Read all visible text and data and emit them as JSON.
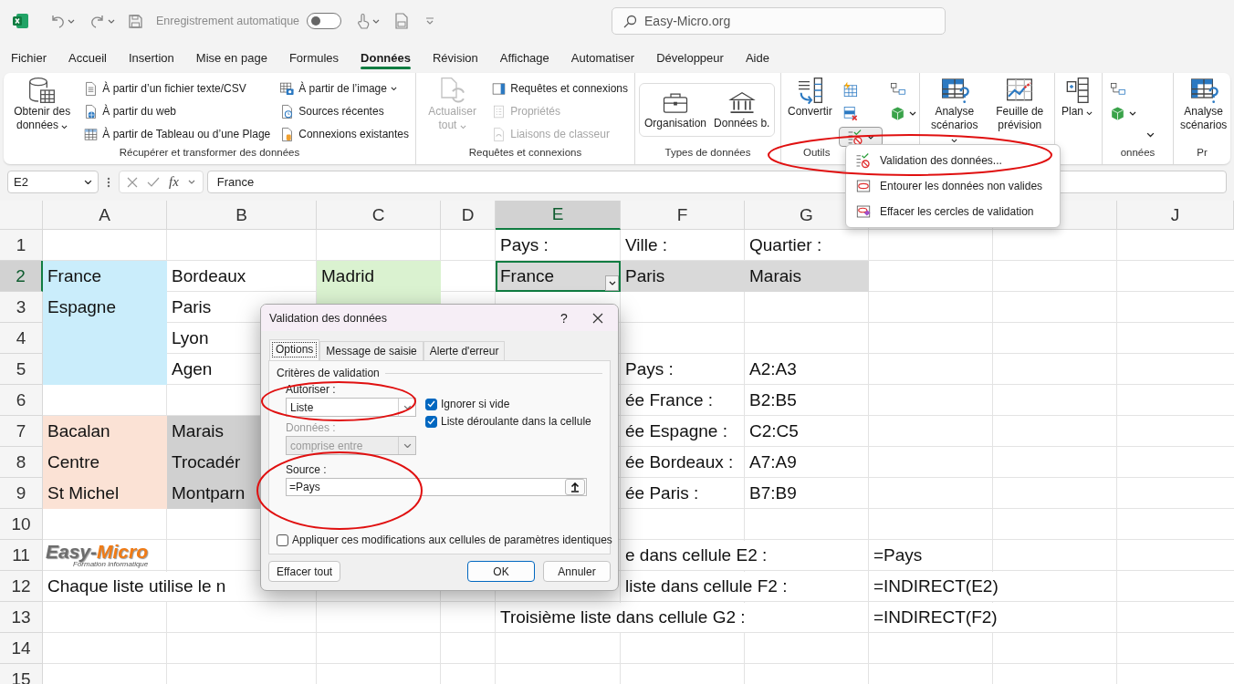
{
  "titlebar": {
    "autosave_label": "Enregistrement automatique",
    "autosave_on": false,
    "search": "Easy-Micro.org"
  },
  "menu_tabs": [
    {
      "label": "Fichier",
      "selected": false
    },
    {
      "label": "Accueil",
      "selected": false
    },
    {
      "label": "Insertion",
      "selected": false
    },
    {
      "label": "Mise en page",
      "selected": false
    },
    {
      "label": "Formules",
      "selected": false
    },
    {
      "label": "Données",
      "selected": true
    },
    {
      "label": "Révision",
      "selected": false
    },
    {
      "label": "Affichage",
      "selected": false
    },
    {
      "label": "Automatiser",
      "selected": false
    },
    {
      "label": "Développeur",
      "selected": false
    },
    {
      "label": "Aide",
      "selected": false
    }
  ],
  "ribbon": [
    {
      "label": "Récupérer et transformer des données",
      "items": [
        {
          "kind": "large",
          "label": "Obtenir des données",
          "dropdown": true,
          "disabled": false
        },
        {
          "kind": "stack",
          "entries": [
            {
              "label": "À partir d’un fichier texte/CSV",
              "dropdown": false,
              "disabled": false
            },
            {
              "label": "À partir du web",
              "dropdown": false,
              "disabled": false
            },
            {
              "label": "À partir de Tableau ou d’une Plage",
              "dropdown": false,
              "disabled": false
            }
          ]
        },
        {
          "kind": "stack",
          "entries": [
            {
              "label": "À partir de l’image",
              "dropdown": true,
              "disabled": false
            },
            {
              "label": "Sources récentes",
              "dropdown": false,
              "disabled": false
            },
            {
              "label": "Connexions existantes",
              "dropdown": false,
              "disabled": false
            }
          ]
        }
      ]
    },
    {
      "label": "Requêtes et connexions",
      "items": [
        {
          "kind": "large",
          "label": "Actualiser tout",
          "dropdown": true,
          "disabled": true
        },
        {
          "kind": "stack",
          "entries": [
            {
              "label": "Requêtes et connexions",
              "dropdown": false,
              "disabled": false
            },
            {
              "label": "Propriétés",
              "dropdown": false,
              "disabled": true
            },
            {
              "label": "Liaisons de classeur",
              "dropdown": false,
              "disabled": true
            }
          ]
        }
      ]
    },
    {
      "label": "Types de données",
      "items": [
        {
          "kind": "gallery",
          "entries": [
            {
              "label": "Organisation"
            },
            {
              "label": "Données b."
            }
          ]
        }
      ]
    },
    {
      "label": "Outils",
      "items": [
        {
          "kind": "large",
          "label": "Convertir",
          "dropdown": false,
          "disabled": false
        },
        {
          "kind": "icons",
          "entries": [
            {
              "dropdown": false,
              "pressed": false
            },
            {
              "dropdown": false,
              "pressed": false
            },
            {
              "dropdown": true,
              "pressed": true
            }
          ]
        },
        {
          "kind": "icons",
          "entries": [
            {
              "dropdown": false,
              "pressed": false
            },
            {
              "dropdown": true,
              "pressed": false
            }
          ]
        }
      ]
    },
    {
      "items": [
        {
          "kind": "large",
          "label": "Analyse scénarios",
          "dropdown": true,
          "disabled": false
        },
        {
          "kind": "large",
          "label": "Feuille de prévision",
          "dropdown": false,
          "disabled": false
        }
      ]
    },
    {
      "items": [
        {
          "kind": "large",
          "label": "Plan",
          "dropdown": true,
          "disabled": false
        }
      ]
    },
    {
      "label": "onnées",
      "items": [
        {
          "kind": "icons",
          "entries": [
            {
              "dropdown": false,
              "pressed": false
            },
            {
              "dropdown": true,
              "pressed": false
            }
          ]
        },
        {
          "kind": "chevron"
        }
      ]
    },
    {
      "label": "Pr",
      "items": [
        {
          "kind": "large",
          "label": "Analyse scénarios",
          "dropdown": false,
          "disabled": false
        }
      ]
    }
  ],
  "formula_bar": {
    "name_box": "E2",
    "fx": "fx",
    "value": "France"
  },
  "sheet": {
    "column_headers": [
      "A",
      "B",
      "C",
      "D",
      "E",
      "F",
      "G",
      "J"
    ],
    "rows": [
      {
        "header": "1",
        "cells": [
          null,
          null,
          null,
          null,
          {
            "text": "Pays :",
            "selected": false
          },
          {
            "text": "Ville :",
            "selected": false
          },
          {
            "text": "Quartier :",
            "selected": false
          },
          null,
          null,
          null
        ]
      },
      {
        "header": "2",
        "cells": [
          {
            "text": "France",
            "color": "#caedfb",
            "selected": false
          },
          {
            "text": "Bordeaux",
            "selected": false
          },
          {
            "text": "Madrid",
            "color": "#daf2d0",
            "selected": false
          },
          null,
          {
            "text": "France",
            "color": "#d9d9d9",
            "selected": true
          },
          {
            "text": "Paris",
            "color": "#d9d9d9",
            "selected": false
          },
          {
            "text": "Marais",
            "color": "#d9d9d9",
            "selected": false
          },
          null,
          null,
          null
        ]
      },
      {
        "header": "3",
        "cells": [
          {
            "text": "Espagne",
            "color": "#caedfb",
            "selected": false
          },
          {
            "text": "Paris",
            "selected": false
          },
          {
            "color": "#daf2d0",
            "selected": false
          },
          null,
          null,
          null,
          null,
          null,
          null,
          null
        ]
      },
      {
        "header": "4",
        "cells": [
          {
            "color": "#caedfb",
            "selected": false
          },
          {
            "text": "Lyon",
            "selected": false
          },
          null,
          null,
          null,
          null,
          null,
          null,
          null,
          null
        ]
      },
      {
        "header": "5",
        "cells": [
          {
            "color": "#caedfb",
            "selected": false
          },
          {
            "text": "Agen",
            "selected": false
          },
          null,
          null,
          null,
          {
            "text": "Pays :",
            "selected": false
          },
          {
            "text": "A2:A3",
            "selected": false
          },
          null,
          null,
          null
        ]
      },
      {
        "header": "6",
        "cells": [
          null,
          null,
          null,
          null,
          null,
          {
            "text": "ée France :",
            "selected": false
          },
          {
            "text": "B2:B5",
            "selected": false
          },
          null,
          null,
          null
        ]
      },
      {
        "header": "7",
        "cells": [
          {
            "text": "Bacalan",
            "color": "#fbe2d5",
            "selected": false
          },
          {
            "text": "Marais",
            "color": "#d0d0d0",
            "selected": false
          },
          null,
          null,
          null,
          {
            "text": "ée Espagne :",
            "selected": false
          },
          {
            "text": "C2:C5",
            "selected": false
          },
          null,
          null,
          null
        ]
      },
      {
        "header": "8",
        "cells": [
          {
            "text": "Centre",
            "color": "#fbe2d5",
            "selected": false
          },
          {
            "text": "Trocadér",
            "color": "#d0d0d0",
            "selected": false
          },
          null,
          null,
          null,
          {
            "text": "ée Bordeaux :",
            "selected": false
          },
          {
            "text": "A7:A9",
            "selected": false
          },
          null,
          null,
          null
        ]
      },
      {
        "header": "9",
        "cells": [
          {
            "text": "St Michel",
            "color": "#fbe2d5",
            "selected": false
          },
          {
            "text": "Montparn",
            "color": "#d0d0d0",
            "selected": false
          },
          null,
          null,
          null,
          {
            "text": "ée Paris :",
            "selected": false
          },
          {
            "text": "B7:B9",
            "selected": false
          },
          null,
          null,
          null
        ]
      },
      {
        "header": "10",
        "cells": [
          null,
          null,
          null,
          null,
          null,
          null,
          null,
          null,
          null,
          null
        ]
      },
      {
        "header": "11",
        "cells": [
          null,
          null,
          null,
          null,
          null,
          {
            "text": "e dans cellule E2 :",
            "selected": false
          },
          null,
          {
            "text": "=Pays",
            "selected": false
          },
          null,
          null
        ]
      },
      {
        "header": "12",
        "cells": [
          {
            "text": "Chaque liste utilise le n",
            "selected": false
          },
          null,
          null,
          null,
          null,
          {
            "text": "liste dans cellule F2 :",
            "selected": false
          },
          null,
          {
            "text": "=INDIRECT(E2)",
            "selected": false
          },
          null,
          null
        ]
      },
      {
        "header": "13",
        "cells": [
          null,
          null,
          null,
          null,
          {
            "text": "Troisième liste dans cellule G2 :",
            "selected": false
          },
          null,
          null,
          {
            "text": "=INDIRECT(F2)",
            "selected": false
          },
          null,
          null
        ]
      },
      {
        "header": "14",
        "cells": [
          null,
          null,
          null,
          null,
          null,
          null,
          null,
          null,
          null,
          null
        ]
      },
      {
        "header": "15",
        "cells": [
          null,
          null,
          null,
          null,
          null,
          null,
          null,
          null,
          null,
          null
        ]
      }
    ],
    "logo": {
      "text": "Easy-",
      "accent": "Micro",
      "tagline": "Formation informatique"
    }
  },
  "dropdown_menu": [
    {
      "label": "Validation des données..."
    },
    {
      "label": "Entourer les données non valides"
    },
    {
      "label": "Effacer les cercles de validation"
    }
  ],
  "dialog": {
    "title": "Validation des données",
    "help": "?",
    "tabs": [
      {
        "label": "Options",
        "selected": true
      },
      {
        "label": "Message de saisie",
        "selected": false
      },
      {
        "label": "Alerte d'erreur",
        "selected": false
      }
    ],
    "section": "Critères de validation",
    "allow_label": "Autoriser :",
    "allow_value": "Liste",
    "checks": [
      {
        "label": "Ignorer si vide",
        "checked": true
      },
      {
        "label": "Liste déroulante dans la cellule",
        "checked": true
      }
    ],
    "data_label": "Données :",
    "data_value": "comprise entre",
    "data_disabled": true,
    "source_label": "Source :",
    "source_value": "=Pays",
    "apply": {
      "label": "Appliquer ces modifications aux cellules de paramètres identiques",
      "checked": false
    },
    "buttons": [
      "Effacer tout",
      "OK",
      "Annuler"
    ]
  }
}
